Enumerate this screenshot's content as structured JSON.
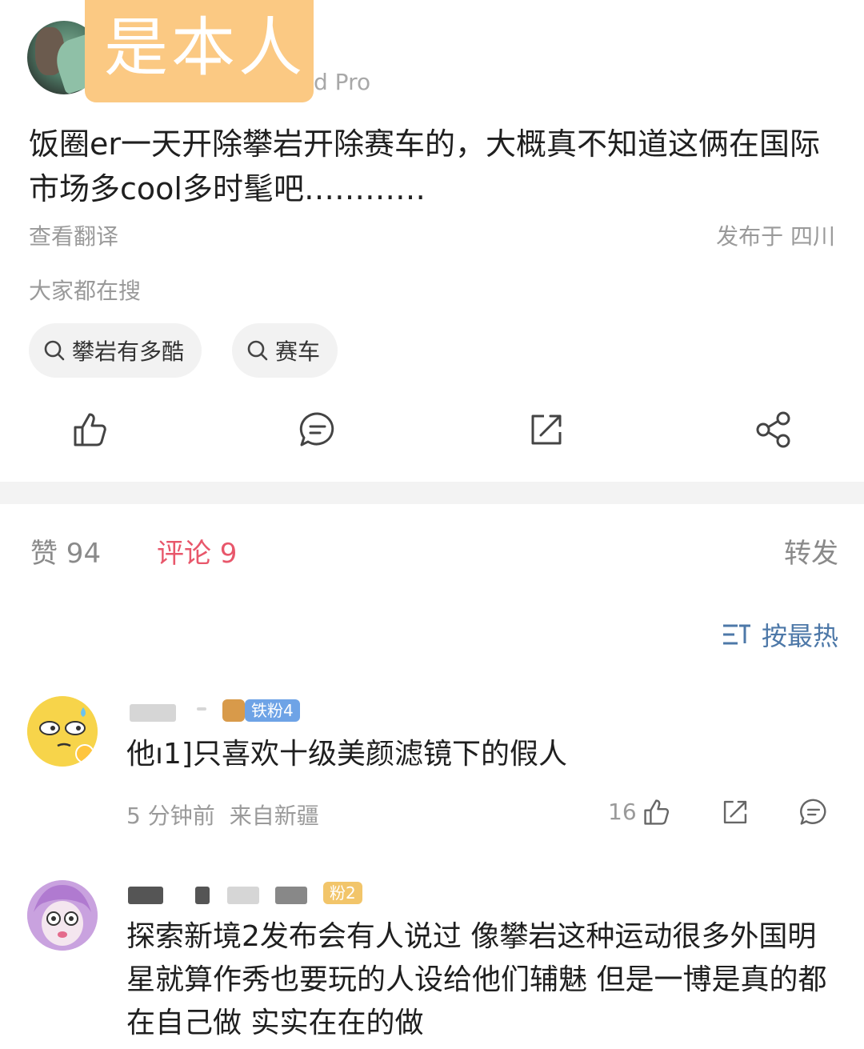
{
  "post": {
    "sticker_text": "是本人",
    "device_suffix": "d Pro",
    "text": "饭圈er一天开除攀岩开除赛车的，大概真不知道这俩在国际市场多cool多时髦吧…………",
    "translate": "查看翻译",
    "location": "发布于 四川",
    "search_hint": "大家都在搜",
    "chips": [
      "攀岩有多酷",
      "赛车"
    ]
  },
  "tabs": {
    "likes": "赞 94",
    "comments": "评论 9",
    "repost": "转发"
  },
  "sort_label": "按最热",
  "comments": [
    {
      "badge": "铁粉4",
      "text": "他ı1]只喜欢十级美颜滤镜下的假人",
      "time": "5 分钟前",
      "source": "来自新疆",
      "likes": "16"
    },
    {
      "badge": "粉2",
      "text": "探索新境2发布会有人说过 像攀岩这种运动很多外国明星就算作秀也要玩的人设给他们辅魅 但是一博是真的都在自己做 实实在在的做"
    }
  ],
  "colors": {
    "accent_red": "#e8576b",
    "link_blue": "#4d78a8",
    "sticker": "#fbc983"
  }
}
